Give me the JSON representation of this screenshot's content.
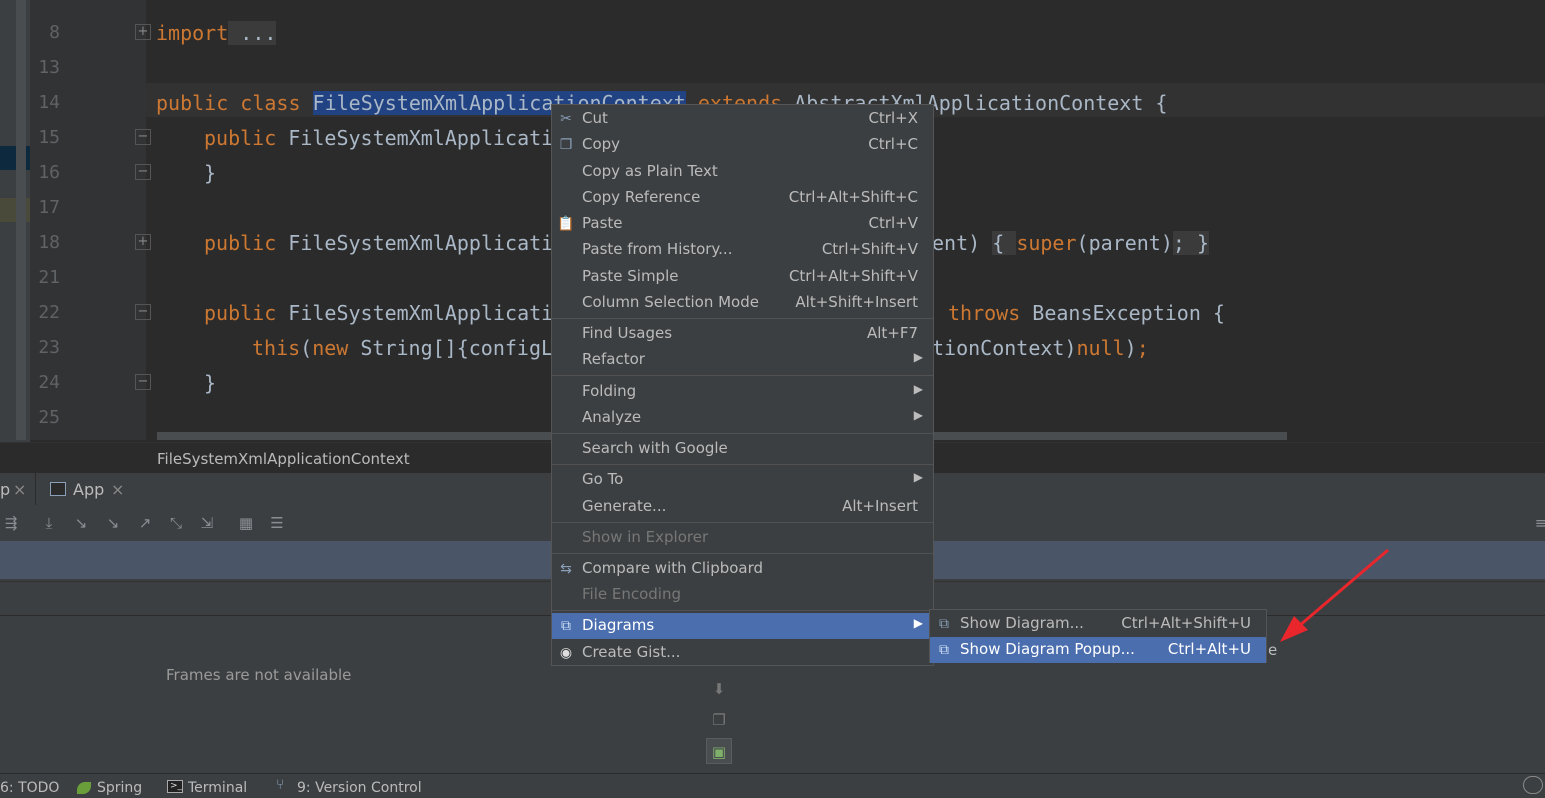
{
  "editor": {
    "line_numbers": [
      "8",
      "13",
      "14",
      "15",
      "16",
      "17",
      "18",
      "21",
      "22",
      "23",
      "24",
      "25"
    ],
    "lines": {
      "l8": {
        "kw": "import",
        "rest": " ..."
      },
      "l14": {
        "kw1": "public class ",
        "sel": "FileSystemXmlApplicationContext",
        "kw2": " extends ",
        "rest": "AbstractXmlApplicationContext {"
      },
      "l15": {
        "kw": "public ",
        "rest": "FileSystemXmlApplicati"
      },
      "l16": {
        "rest": "}"
      },
      "l18": {
        "kw": "public ",
        "rest": "FileSystemXmlApplicati",
        "tail_a": "ent) ",
        "tail_b": "{ ",
        "tail_kw": "super",
        "tail_c": "(parent)",
        "tail_d": "; }"
      },
      "l22": {
        "kw": "public ",
        "rest": "FileSystemXmlApplicati",
        "tail_kw": "throws ",
        "tail_rest": "BeansException {"
      },
      "l23": {
        "kw1": "this",
        "p1": "(",
        "kw2": "new ",
        "rest": "String[]{configL",
        "tail_a": "tionContext)",
        "tail_kw": "null",
        "tail_b": ")",
        "tail_c": ";"
      },
      "l24": {
        "rest": "}"
      }
    },
    "breadcrumb": "FileSystemXmlApplicationContext"
  },
  "tool_tabs": {
    "prev_close": "×",
    "app_label": "App",
    "app_close": "×",
    "prev_partial": "p"
  },
  "panel": {
    "frames_msg": "Frames are not available",
    "partial_text": "e"
  },
  "status_bar": {
    "todo": "6: TODO",
    "spring": "Spring",
    "terminal": "Terminal",
    "vcs": "9: Version Control"
  },
  "context_menu": {
    "items": [
      {
        "label": "Cut",
        "shortcut": "Ctrl+X"
      },
      {
        "label": "Copy",
        "shortcut": "Ctrl+C"
      },
      {
        "label": "Copy as Plain Text",
        "shortcut": ""
      },
      {
        "label": "Copy Reference",
        "shortcut": "Ctrl+Alt+Shift+C"
      },
      {
        "label": "Paste",
        "shortcut": "Ctrl+V"
      },
      {
        "label": "Paste from History...",
        "shortcut": "Ctrl+Shift+V"
      },
      {
        "label": "Paste Simple",
        "shortcut": "Ctrl+Alt+Shift+V"
      },
      {
        "label": "Column Selection Mode",
        "shortcut": "Alt+Shift+Insert"
      },
      {
        "label": "Find Usages",
        "shortcut": "Alt+F7"
      },
      {
        "label": "Refactor",
        "shortcut": ""
      },
      {
        "label": "Folding",
        "shortcut": ""
      },
      {
        "label": "Analyze",
        "shortcut": ""
      },
      {
        "label": "Search with Google",
        "shortcut": ""
      },
      {
        "label": "Go To",
        "shortcut": ""
      },
      {
        "label": "Generate...",
        "shortcut": "Alt+Insert"
      },
      {
        "label": "Show in Explorer",
        "shortcut": ""
      },
      {
        "label": "Compare with Clipboard",
        "shortcut": ""
      },
      {
        "label": "File Encoding",
        "shortcut": ""
      },
      {
        "label": "Diagrams",
        "shortcut": ""
      },
      {
        "label": "Create Gist...",
        "shortcut": ""
      }
    ],
    "submenu_arrow": "▶"
  },
  "submenu": {
    "items": [
      {
        "label": "Show Diagram...",
        "shortcut": "Ctrl+Alt+Shift+U"
      },
      {
        "label": "Show Diagram Popup...",
        "shortcut": "Ctrl+Alt+U"
      }
    ]
  },
  "colors": {
    "accent": "#4b6eaf",
    "selection": "#214283",
    "keyword": "#cc7832",
    "annotation_arrow": "#e8262c"
  }
}
